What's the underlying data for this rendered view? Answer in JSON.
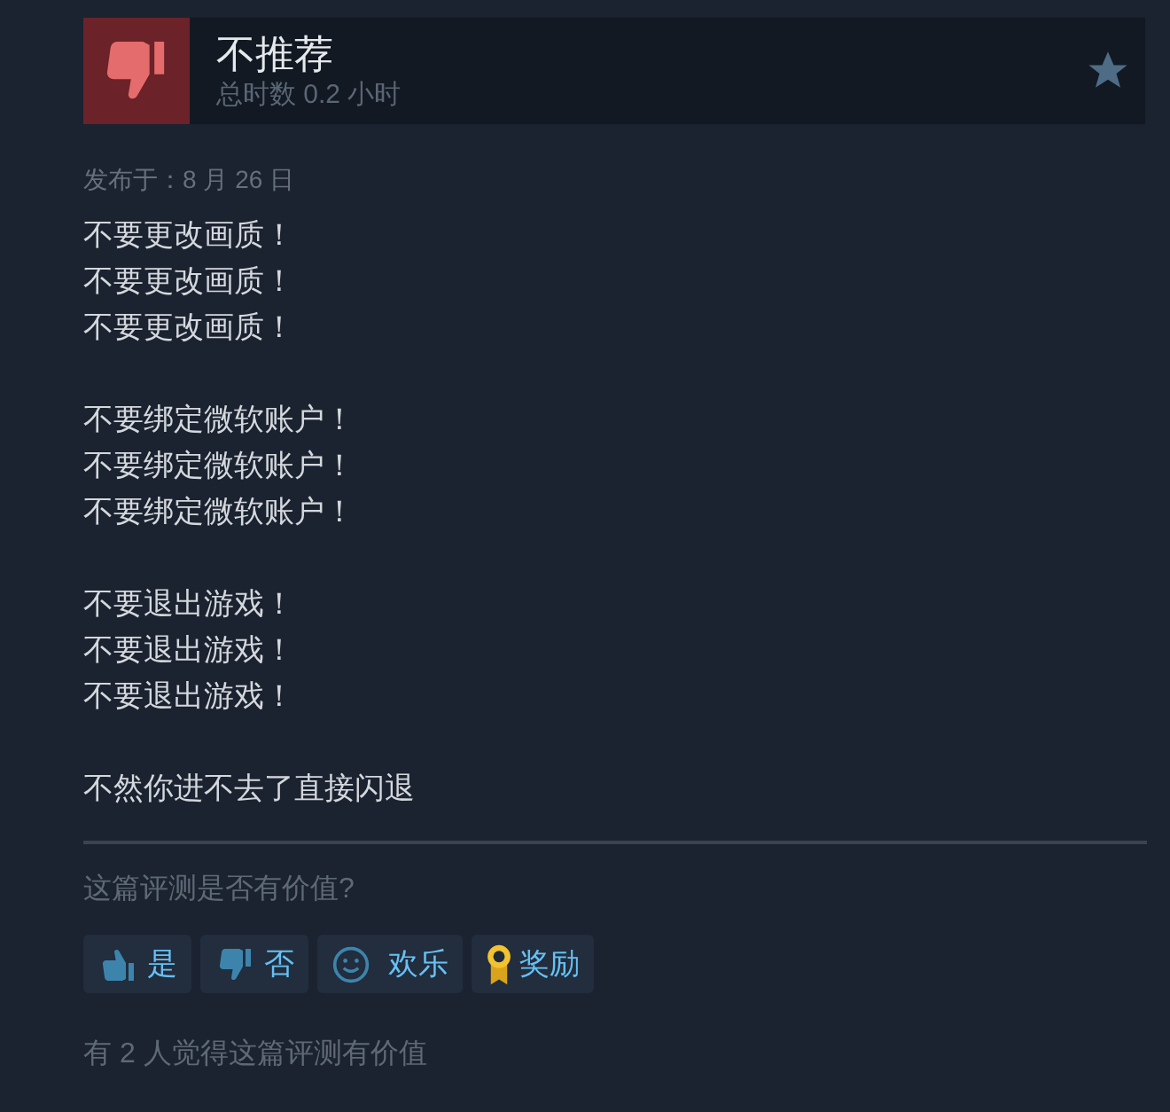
{
  "header": {
    "verdict": "不推荐",
    "playtime": "总时数 0.2 小时"
  },
  "posted": "发布于：8 月 26 日",
  "paragraphs": [
    [
      "不要更改画质！",
      "不要更改画质！",
      "不要更改画质！"
    ],
    [
      "不要绑定微软账户！",
      "不要绑定微软账户！",
      "不要绑定微软账户！"
    ],
    [
      "不要退出游戏！",
      "不要退出游戏！",
      "不要退出游戏！"
    ],
    [
      "不然你进不去了直接闪退"
    ]
  ],
  "helpful_prompt": "这篇评测是否有价值?",
  "buttons": [
    {
      "kind": "thumbs_up",
      "label": "是"
    },
    {
      "kind": "thumbs_down",
      "label": "否"
    },
    {
      "kind": "smile",
      "label": "欢乐"
    },
    {
      "kind": "award",
      "label": "奖励"
    }
  ],
  "helpful_count": "有 2 人觉得这篇评测有价值"
}
